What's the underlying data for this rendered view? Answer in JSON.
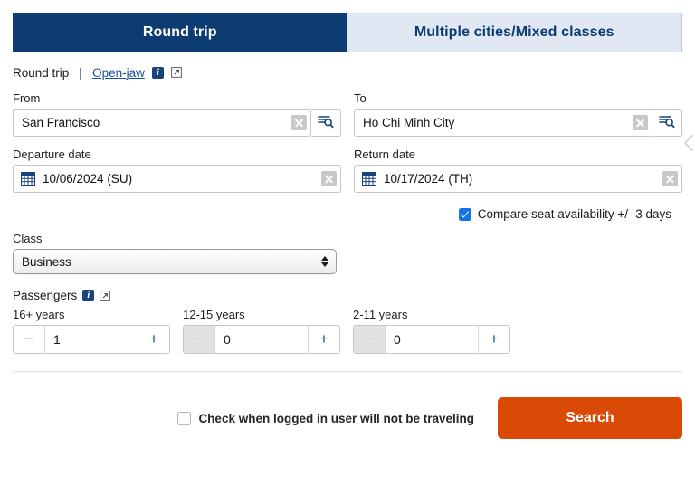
{
  "tabs": [
    {
      "label": "Round trip",
      "active": true
    },
    {
      "label": "Multiple cities/Mixed classes",
      "active": false
    }
  ],
  "trip_links": {
    "current": "Round trip",
    "separator": "|",
    "open_jaw": "Open-jaw",
    "info_icon": "info-icon",
    "external_icon": "external-link-icon"
  },
  "route": {
    "from": {
      "label": "From",
      "value": "San Francisco",
      "clear_icon": "clear-icon",
      "lookup_icon": "lookup-search-icon"
    },
    "to": {
      "label": "To",
      "value": "Ho Chi Minh City",
      "clear_icon": "clear-icon",
      "lookup_icon": "lookup-search-icon"
    }
  },
  "dates": {
    "departure": {
      "label": "Departure date",
      "value": "10/06/2024 (SU)",
      "calendar_icon": "calendar-icon",
      "clear_icon": "clear-icon"
    },
    "return": {
      "label": "Return date",
      "value": "10/17/2024 (TH)",
      "calendar_icon": "calendar-icon",
      "clear_icon": "clear-icon"
    }
  },
  "compare": {
    "label": "Compare seat availability +/- 3 days",
    "checked": true
  },
  "class": {
    "label": "Class",
    "value": "Business",
    "options": [
      "Business"
    ]
  },
  "passengers": {
    "title": "Passengers",
    "info_icon": "info-icon",
    "external_icon": "external-link-icon",
    "groups": [
      {
        "label": "16+ years",
        "value": "1",
        "minus": "−",
        "plus": "+",
        "minus_disabled": false
      },
      {
        "label": "12-15 years",
        "value": "0",
        "minus": "−",
        "plus": "+",
        "minus_disabled": true
      },
      {
        "label": "2-11 years",
        "value": "0",
        "minus": "−",
        "plus": "+",
        "minus_disabled": true
      }
    ]
  },
  "footer": {
    "logged_out_label": "Check when logged in user will not be traveling",
    "logged_out_checked": false,
    "search_label": "Search"
  },
  "colors": {
    "tab_active_bg": "#0c3c71",
    "tab_inactive_bg": "#e2e7f4",
    "link": "#1d4f9c",
    "checkbox_checked": "#1473e6",
    "search_button": "#d84a05",
    "icon_navy": "#17427c"
  }
}
